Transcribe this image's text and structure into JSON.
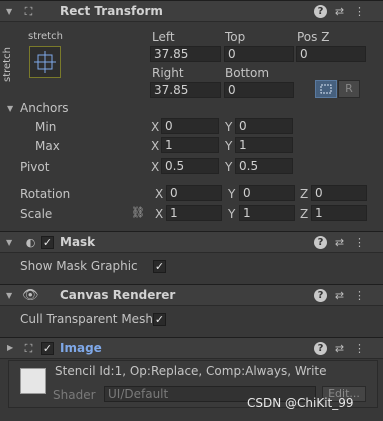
{
  "rect_transform": {
    "title": "Rect Transform",
    "anchor_preset": {
      "horizontal": "stretch",
      "vertical": "stretch"
    },
    "labels": {
      "left": "Left",
      "top": "Top",
      "pos_z": "Pos Z",
      "right": "Right",
      "bottom": "Bottom"
    },
    "values": {
      "left": "37.85",
      "top": "0",
      "pos_z": "0",
      "right": "37.85",
      "bottom": "0"
    },
    "anchors": {
      "label": "Anchors",
      "min": {
        "label": "Min",
        "x": "0",
        "y": "0"
      },
      "max": {
        "label": "Max",
        "x": "1",
        "y": "1"
      }
    },
    "pivot": {
      "label": "Pivot",
      "x": "0.5",
      "y": "0.5"
    },
    "rotation": {
      "label": "Rotation",
      "x": "0",
      "y": "0",
      "z": "0"
    },
    "scale": {
      "label": "Scale",
      "x": "1",
      "y": "1",
      "z": "1"
    },
    "axis_labels": {
      "x": "X",
      "y": "Y",
      "z": "Z"
    },
    "blueprint_button": "R"
  },
  "mask": {
    "title": "Mask",
    "show_mask_graphic_label": "Show Mask Graphic",
    "check": "✓"
  },
  "canvas_renderer": {
    "title": "Canvas Renderer",
    "cull_label": "Cull Transparent Mesh",
    "check": "✓"
  },
  "image": {
    "title": "Image",
    "check": "✓",
    "stencil_info": "Stencil Id:1, Op:Replace, Comp:Always, Write",
    "shader_label": "Shader",
    "shader_value": "UI/Default",
    "edit_button": "Edit..."
  },
  "watermark": "CSDN @ChiKit_99",
  "colors": {
    "background": "#383838",
    "header": "#3e3e3e",
    "field": "#2a2a2a",
    "accent_blue": "#7fa8e8"
  }
}
